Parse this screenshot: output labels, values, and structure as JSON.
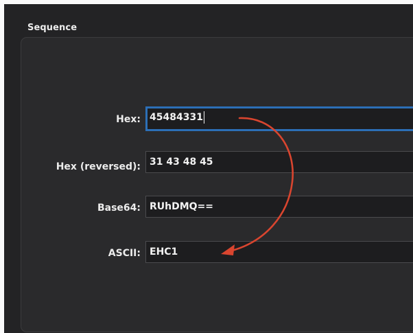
{
  "group": {
    "title": "Sequence"
  },
  "rows": [
    {
      "label": "Hex:",
      "value": "45484331"
    },
    {
      "label": "Hex (reversed):",
      "value": "31 43 48 45"
    },
    {
      "label": "Base64:",
      "value": "RUhDMQ=="
    },
    {
      "label": "ASCII:",
      "value": "EHC1"
    }
  ],
  "annotation": {
    "arrow_color": "#d9452f"
  },
  "colors": {
    "focus_ring": "#2c6fb7",
    "panel_background": "#2a2a2c",
    "field_background": "#1d1d1f"
  }
}
